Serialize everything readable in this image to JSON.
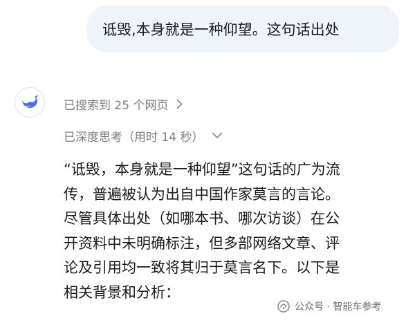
{
  "user_message": "诋毁,本身就是一种仰望。这句话出处",
  "assistant": {
    "avatar_icon": "deepseek-whale-icon",
    "search_status": "已搜索到 25 个网页",
    "think_status": "已深度思考（用时 14 秒）",
    "answer_lines": [
      "“诋毁，本身就是一种仰望”这句话的广为流",
      "传，普遍被认为出自中国作家莫言的言论。",
      "尽管具体出处（如哪本书、哪次访谈）在公",
      "开资料中未明确标注，但多部网络文章、评",
      "论及引用均一致将其归于莫言名下。以下是",
      "相关背景和分析："
    ]
  },
  "watermark": {
    "text": "公众号 · 智能车参考",
    "icon": "wechat-official-account-icon"
  },
  "colors": {
    "user_bubble": "#eff3fa",
    "brand_blue": "#4d6bfe",
    "meta_gray": "#7d7d7d"
  }
}
